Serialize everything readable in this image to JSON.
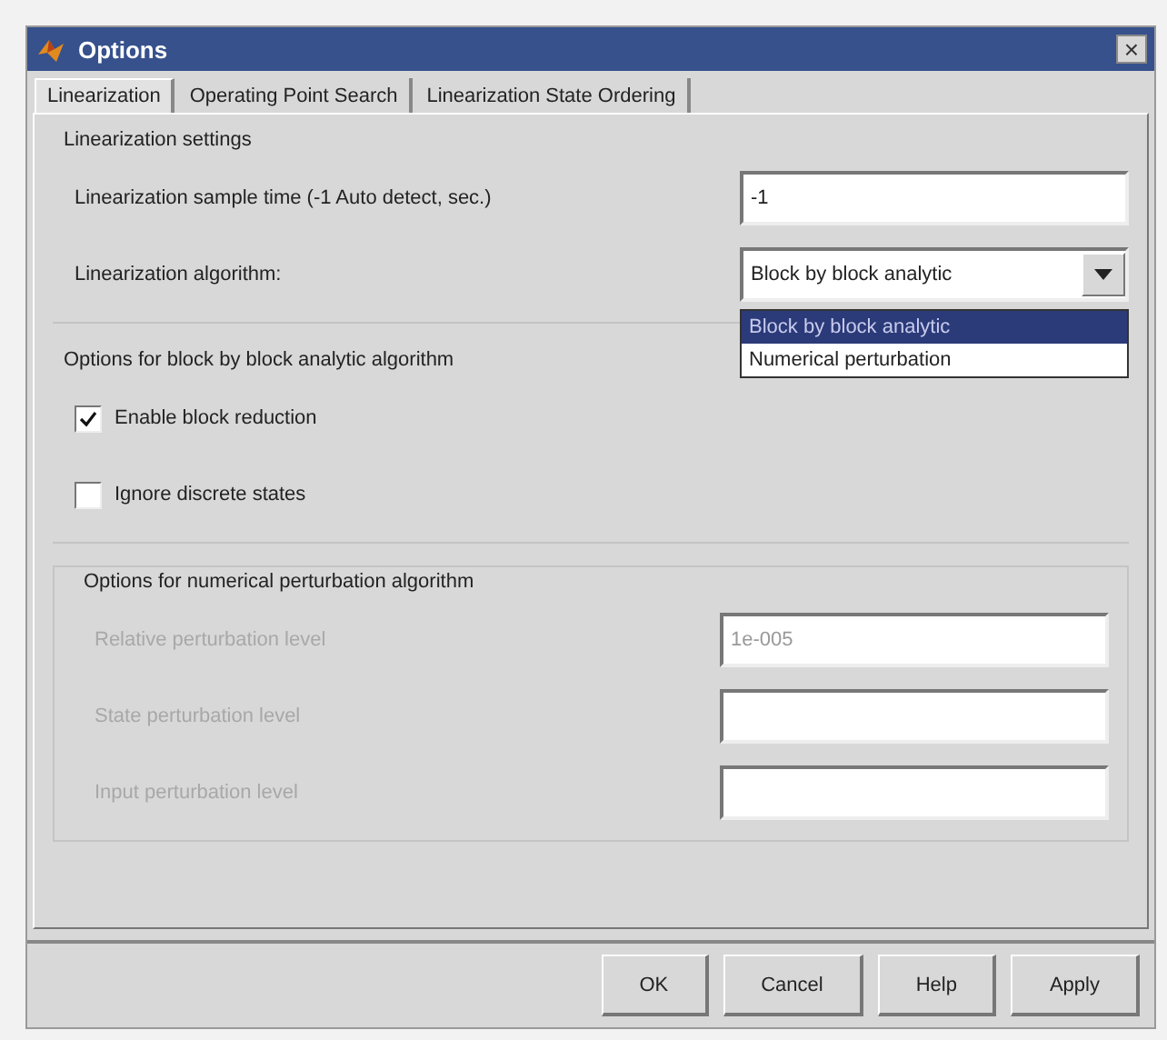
{
  "window": {
    "title": "Options",
    "close": "×"
  },
  "tabs": [
    {
      "label": "Linearization",
      "selected": true
    },
    {
      "label": "Operating Point Search",
      "selected": false
    },
    {
      "label": "Linearization State Ordering",
      "selected": false
    }
  ],
  "sections": [
    {
      "title": "Linearization settings",
      "disabled": false,
      "rows": [
        {
          "kind": "text",
          "label": "Linearization sample time (-1 Auto detect, sec.)",
          "value": "-1"
        },
        {
          "kind": "dropdown",
          "label": "Linearization algorithm:",
          "value": "Block by block analytic",
          "expanded": true,
          "options": [
            {
              "label": "Block by block analytic",
              "selected": true
            },
            {
              "label": "Numerical perturbation",
              "selected": false
            }
          ]
        }
      ]
    },
    {
      "title": "Options for block by block analytic algorithm",
      "disabled": false,
      "rows": [
        {
          "kind": "checkbox",
          "label": "Enable block reduction",
          "checked": true
        },
        {
          "kind": "checkbox",
          "label": "Ignore discrete states",
          "checked": false
        }
      ]
    },
    {
      "title": "Options for numerical perturbation algorithm",
      "disabled": true,
      "rows": [
        {
          "kind": "text",
          "label": "Relative perturbation level",
          "value": "1e-005"
        },
        {
          "kind": "text",
          "label": "State perturbation level"
        },
        {
          "kind": "text",
          "label": "Input perturbation level"
        }
      ]
    }
  ],
  "buttons": [
    "OK",
    "Cancel",
    "Help",
    "Apply"
  ]
}
